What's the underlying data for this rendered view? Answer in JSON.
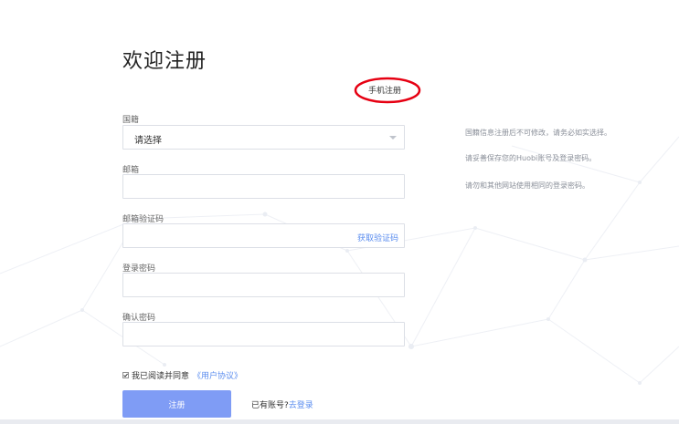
{
  "page": {
    "title": "欢迎注册",
    "phone_register_link": "手机注册"
  },
  "form": {
    "nationality": {
      "label": "国籍",
      "selected": "请选择"
    },
    "email": {
      "label": "邮箱",
      "value": ""
    },
    "email_code": {
      "label": "邮箱验证码",
      "value": "",
      "action": "获取验证码"
    },
    "password": {
      "label": "登录密码",
      "value": ""
    },
    "confirm_password": {
      "label": "确认密码",
      "value": ""
    },
    "agreement": {
      "text": "我已阅读并同意",
      "link": "《用户协议》",
      "checked": true
    },
    "register_button": "注册",
    "login_prompt": "已有账号?",
    "login_link": "去登录"
  },
  "tips": [
    "国籍信息注册后不可修改，请务必如实选择。",
    "请妥善保存您的Huobi账号及登录密码。",
    "请勿和其他网站使用相同的登录密码。"
  ],
  "colors": {
    "accent": "#5b8def",
    "button": "#7f9cf5",
    "highlight": "#e60012"
  }
}
